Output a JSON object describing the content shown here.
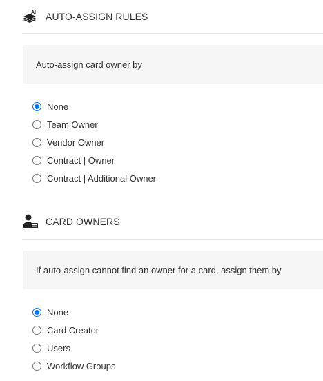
{
  "auto_assign": {
    "icon": "stacked-layers-ai-icon",
    "title": "AUTO-ASSIGN RULES",
    "prompt": "Auto-assign card owner by",
    "options": [
      {
        "label": "None",
        "checked": true
      },
      {
        "label": "Team Owner",
        "checked": false
      },
      {
        "label": "Vendor Owner",
        "checked": false
      },
      {
        "label": "Contract | Owner",
        "checked": false
      },
      {
        "label": "Contract | Additional Owner",
        "checked": false
      }
    ]
  },
  "card_owners": {
    "icon": "person-card-icon",
    "title": "CARD OWNERS",
    "prompt": "If auto-assign cannot find an owner for a card, assign them by",
    "options": [
      {
        "label": "None",
        "checked": true
      },
      {
        "label": "Card Creator",
        "checked": false
      },
      {
        "label": "Users",
        "checked": false
      },
      {
        "label": "Workflow Groups",
        "checked": false
      }
    ]
  },
  "colors": {
    "accent": "#0075ff",
    "panel_bg": "#f6f6f6",
    "divider": "#e4e4e4"
  }
}
